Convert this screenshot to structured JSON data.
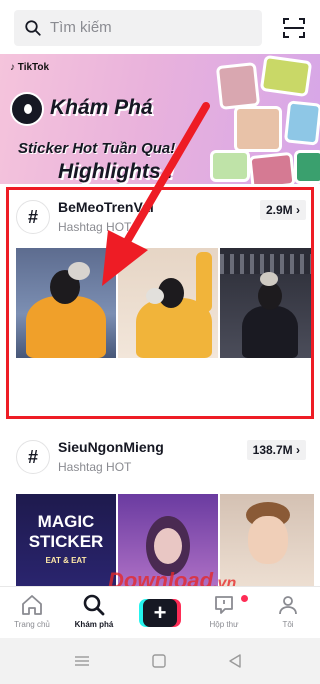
{
  "search": {
    "placeholder": "Tìm kiếm",
    "icon": "search-icon",
    "scan_icon": "scan-icon"
  },
  "banner": {
    "brand": "♪ TikTok",
    "line1": "Khám Phá",
    "line2": "Sticker Hot Tuần Qua!",
    "line3": "Highlights !"
  },
  "hashtags": [
    {
      "name": "BeMeoTrenVai",
      "subtitle": "Hashtag HOT",
      "count": "2.9M ›"
    },
    {
      "name": "SieuNgonMieng",
      "subtitle": "Hashtag HOT",
      "count": "138.7M ›"
    }
  ],
  "magic_sticker": {
    "title": "MAGIC STICKER",
    "subtitle": "EAT & EAT"
  },
  "watermark": {
    "text": "Download",
    "suffix": ".vn"
  },
  "nav": {
    "items": [
      {
        "label": "Trang chủ",
        "icon": "home-icon"
      },
      {
        "label": "Khám phá",
        "icon": "discover-icon"
      },
      {
        "label": "",
        "icon": "create-icon"
      },
      {
        "label": "Hộp thư",
        "icon": "inbox-icon"
      },
      {
        "label": "Tôi",
        "icon": "profile-icon"
      }
    ]
  },
  "colors": {
    "highlight": "#ee1c25",
    "accent_red": "#fe2c55",
    "accent_cyan": "#25f4ee"
  }
}
